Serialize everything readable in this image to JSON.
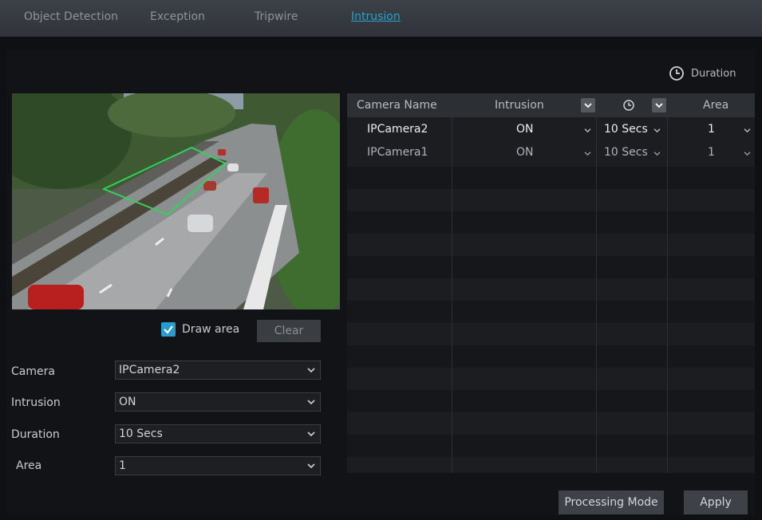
{
  "tabs": [
    {
      "label": "Object Detection",
      "active": false
    },
    {
      "label": "Exception",
      "active": false
    },
    {
      "label": "Tripwire",
      "active": false
    },
    {
      "label": "Intrusion",
      "active": true
    }
  ],
  "legend": {
    "label": "Duration",
    "icon": "clock-icon"
  },
  "preview": {
    "icon": "camera-preview"
  },
  "draw_area": {
    "label": "Draw area",
    "checked": true
  },
  "clear_button": "Clear",
  "form": {
    "camera": {
      "label": "Camera",
      "value": "IPCamera2"
    },
    "intrusion": {
      "label": "Intrusion",
      "value": "ON"
    },
    "duration": {
      "label": "Duration",
      "value": "10 Secs"
    },
    "area": {
      "label": "Area",
      "value": "1"
    }
  },
  "table": {
    "headers": {
      "camera_name": "Camera Name",
      "intrusion": "Intrusion",
      "area": "Area"
    },
    "rows": [
      {
        "camera": "IPCamera2",
        "intrusion": "ON",
        "duration": "10 Secs",
        "area": "1",
        "selected": true
      },
      {
        "camera": "IPCamera1",
        "intrusion": "ON",
        "duration": "10 Secs",
        "area": "1",
        "selected": false
      }
    ]
  },
  "buttons": {
    "processing_mode": "Processing Mode",
    "apply": "Apply"
  },
  "colors": {
    "accent": "#2aa3c9",
    "background": "#0f1013",
    "header": "#2c2f34",
    "region_outline": "#2fd35a"
  }
}
